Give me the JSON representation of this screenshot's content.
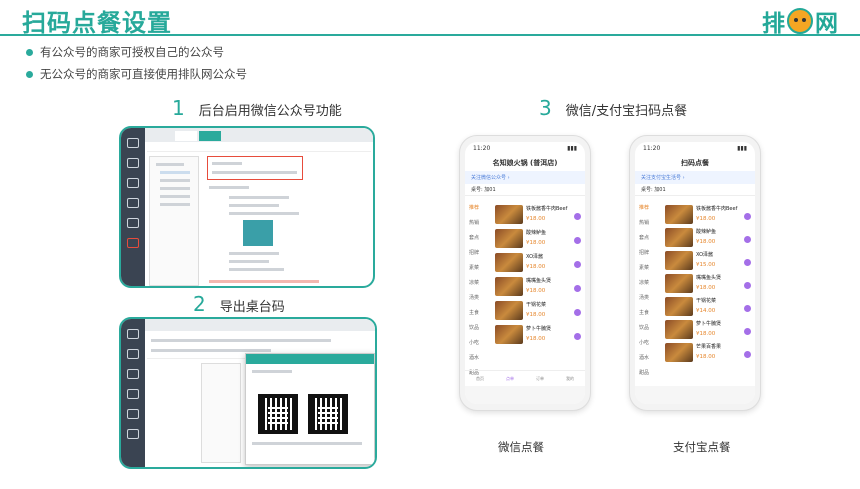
{
  "page": {
    "title": "扫码点餐设置",
    "logo_text_left": "排",
    "logo_text_right": "网"
  },
  "bullets": [
    "有公众号的商家可授权自己的公众号",
    "无公众号的商家可直接使用排队网公众号"
  ],
  "steps": [
    {
      "num": "1",
      "label": "后台启用微信公众号功能"
    },
    {
      "num": "2",
      "label": "导出桌台码"
    },
    {
      "num": "3",
      "label": "微信/支付宝扫码点餐"
    }
  ],
  "phones": [
    {
      "time": "11:20",
      "title": "名知娘火锅 (普洱店)",
      "banner": "关注微信公众号 ›",
      "seat": "桌号: 加01",
      "categories": [
        "推荐",
        "热销",
        "套点",
        "招牌",
        "素菜",
        "凉菜",
        "汤类",
        "主食",
        "饮品",
        "小吃",
        "酒水",
        "甜品"
      ],
      "items": [
        {
          "name": "铁板酱香牛肉Beef",
          "price": "¥18.00"
        },
        {
          "name": "酸辣鲈鱼",
          "price": "¥18.00"
        },
        {
          "name": "XO泽酱",
          "price": "¥18.00"
        },
        {
          "name": "嘴嘴鱼头煲",
          "price": "¥18.00"
        },
        {
          "name": "干锅花菜",
          "price": "¥18.00"
        },
        {
          "name": "萝卜牛腩煲",
          "price": "¥18.00"
        }
      ],
      "tabs": [
        "首页",
        "点单",
        "订单",
        "我的"
      ],
      "caption": "微信点餐"
    },
    {
      "time": "11:20",
      "title": "扫码点餐",
      "banner": "关注支付宝生活号 ›",
      "seat": "桌号: 加01",
      "categories": [
        "推荐",
        "热销",
        "套点",
        "招牌",
        "素菜",
        "凉菜",
        "汤类",
        "主食",
        "饮品",
        "小吃",
        "酒水",
        "甜品"
      ],
      "items": [
        {
          "name": "铁板酱香牛肉Beef",
          "price": "¥18.00"
        },
        {
          "name": "酸辣鲈鱼",
          "price": "¥18.00"
        },
        {
          "name": "XO泽酱",
          "price": "¥15.00"
        },
        {
          "name": "嘴嘴鱼头煲",
          "price": "¥18.00"
        },
        {
          "name": "干锅花菜",
          "price": "¥14.00"
        },
        {
          "name": "萝卜牛腩煲",
          "price": "¥18.00"
        },
        {
          "name": "芒果百香果",
          "price": "¥18.00"
        }
      ],
      "tabs": [],
      "caption": "支付宝点餐"
    }
  ],
  "colors": {
    "accent": "#2aaa9c",
    "price": "#e6862b",
    "add": "#a46fe8"
  }
}
